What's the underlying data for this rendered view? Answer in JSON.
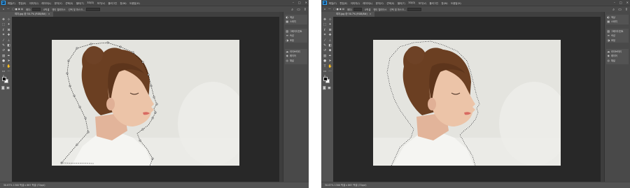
{
  "colors": {
    "app_bg": "#535353",
    "doc_bg": "#282828",
    "menubar_bg": "#454545",
    "brand_accent": "#31a8ff",
    "selection_ants": "#000000"
  },
  "screens": [
    {
      "id": "left",
      "menu_items": [
        "파일(F)",
        "편집(E)",
        "이미지(I)",
        "레이어(L)",
        "문자(Y)",
        "선택(S)",
        "필터(T)",
        "3D(D)",
        "보기(V)",
        "플러그인",
        "창(W)",
        "도움말(H)"
      ],
      "options": [
        "□ ■ ▣ ▤",
        "페더:",
        "0픽셀",
        "앤티 앨리어스",
        "선택 및 마스크..."
      ],
      "tab_label": "여자.jpg @ 50.7% (RGB/8#)",
      "panels": [
        "색상",
        "스와치",
        "그레이디언트",
        "속성",
        "조정",
        "라이브러리",
        "레이어",
        "채널",
        "패스"
      ],
      "status": "50.67%   1300 픽셀 x 867 픽셀 (72ppi)",
      "selection_style": "polygonal-lasso-in-progress"
    },
    {
      "id": "right",
      "menu_items": [
        "파일(F)",
        "편집(E)",
        "이미지(I)",
        "레이어(L)",
        "문자(Y)",
        "선택(S)",
        "필터(T)",
        "3D(D)",
        "보기(V)",
        "플러그인",
        "창(W)",
        "도움말(H)"
      ],
      "options": [
        "□ ■ ▣ ▤",
        "페더:",
        "0픽셀",
        "앤티 앨리어스",
        "선택 및 마스크..."
      ],
      "tab_label": "여자.jpg @ 50.7% (RGB/8#)",
      "panels": [
        "색상",
        "스와치",
        "그레이디언트",
        "속성",
        "조정",
        "라이브러리",
        "레이어",
        "채널",
        "패스"
      ],
      "status": "50.67%   1300 픽셀 x 867 픽셀 (72ppi)",
      "selection_style": "marching-ants-closed"
    }
  ],
  "tool_icons": [
    "move-icon",
    "artboard-icon",
    "marquee-icon",
    "lasso-icon",
    "quick-select-icon",
    "crop-icon",
    "frame-icon",
    "eyedropper-icon",
    "spot-heal-icon",
    "brush-icon",
    "clone-stamp-icon",
    "history-brush-icon",
    "eraser-icon",
    "gradient-icon",
    "blur-icon",
    "dodge-icon",
    "pen-icon",
    "type-icon",
    "path-select-icon",
    "rectangle-icon",
    "hand-icon",
    "zoom-icon",
    "more-tools-icon"
  ]
}
